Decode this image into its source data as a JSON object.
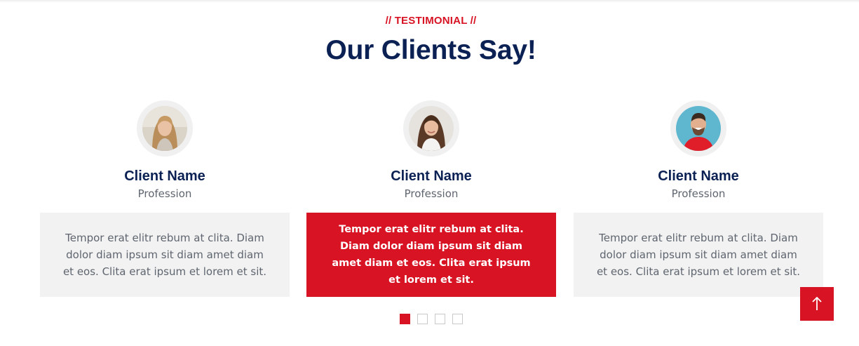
{
  "section": {
    "eyebrow": "// TESTIMONIAL //",
    "title": "Our Clients Say!"
  },
  "testimonials": [
    {
      "name": "Client Name",
      "profession": "Profession",
      "text": "Tempor erat elitr rebum at clita. Diam dolor diam ipsum sit diam amet diam et eos. Clita erat ipsum et lorem et sit.",
      "active": false
    },
    {
      "name": "Client Name",
      "profession": "Profession",
      "text": "Tempor erat elitr rebum at clita. Diam dolor diam ipsum sit diam amet diam et eos. Clita erat ipsum et lorem et sit.",
      "active": true
    },
    {
      "name": "Client Name",
      "profession": "Profession",
      "text": "Tempor erat elitr rebum at clita. Diam dolor diam ipsum sit diam amet diam et eos. Clita erat ipsum et lorem et sit.",
      "active": false
    }
  ],
  "carousel": {
    "dot_count": 4,
    "active_index": 0
  },
  "back_to_top": {
    "icon": "arrow-up-icon"
  },
  "colors": {
    "accent": "#d81324",
    "heading": "#0b2154",
    "muted": "#5f656f",
    "card_bg": "#f2f2f2"
  }
}
